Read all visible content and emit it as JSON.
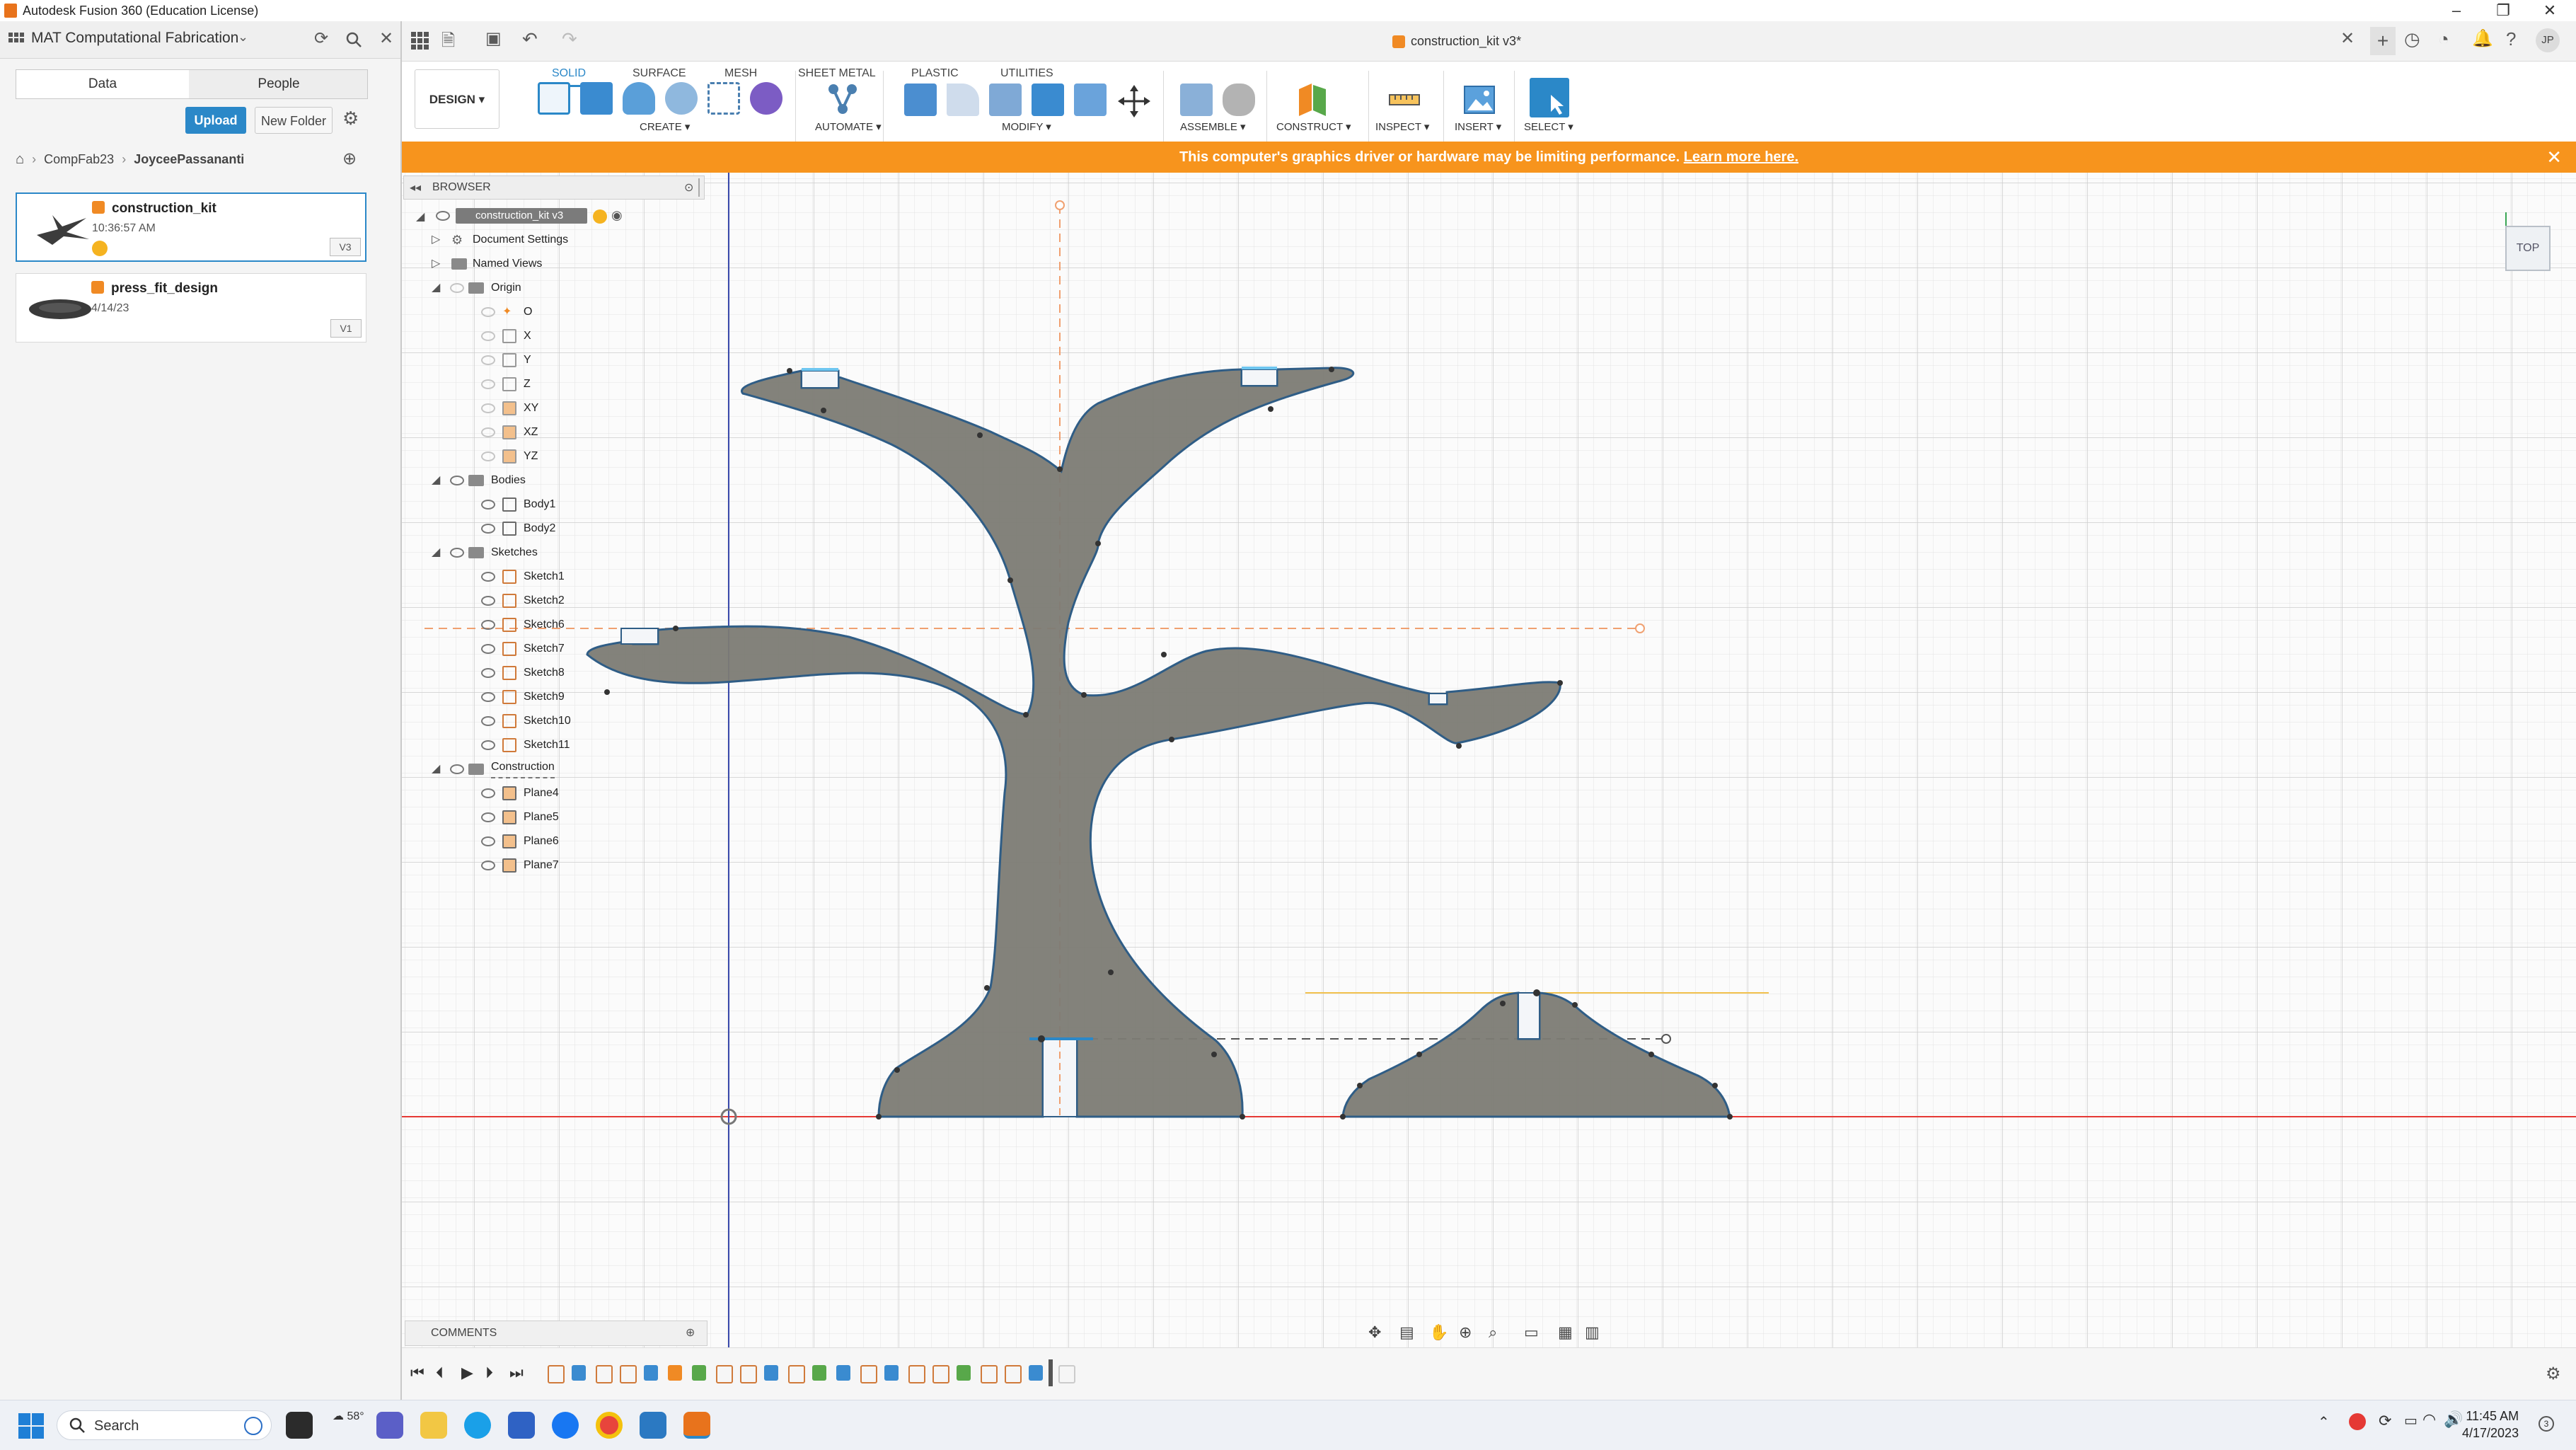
{
  "window": {
    "title": "Autodesk Fusion 360 (Education License)",
    "minimize": "–",
    "maximize": "❐",
    "close": "✕"
  },
  "data_panel": {
    "team": "MAT Computational Fabrication",
    "tabs": [
      "Data",
      "People"
    ],
    "upload": "Upload",
    "new_folder": "New Folder",
    "breadcrumb": [
      "CompFab23",
      "JoyceePassananti"
    ],
    "files": [
      {
        "name": "construction_kit",
        "date": "10:36:57 AM",
        "version": "V3"
      },
      {
        "name": "press_fit_design",
        "date": "4/14/23",
        "version": "V1"
      }
    ]
  },
  "document": {
    "tab_title": "construction_kit v3*",
    "user_initials": "JP"
  },
  "toolbar": {
    "design": "DESIGN",
    "workspace_tabs": [
      "SOLID",
      "SURFACE",
      "MESH",
      "SHEET METAL",
      "PLASTIC",
      "UTILITIES"
    ],
    "groups": [
      "CREATE",
      "AUTOMATE",
      "MODIFY",
      "ASSEMBLE",
      "CONSTRUCT",
      "INSPECT",
      "INSERT",
      "SELECT"
    ]
  },
  "warning": {
    "text": "This computer's graphics driver or hardware may be limiting performance.",
    "link": "Learn more here."
  },
  "browser": {
    "title": "BROWSER",
    "root": "construction_kit v3",
    "document_settings": "Document Settings",
    "named_views": "Named Views",
    "origin": {
      "label": "Origin",
      "items": [
        "O",
        "X",
        "Y",
        "Z",
        "XY",
        "XZ",
        "YZ"
      ]
    },
    "bodies": {
      "label": "Bodies",
      "items": [
        "Body1",
        "Body2"
      ]
    },
    "sketches": {
      "label": "Sketches",
      "items": [
        "Sketch1",
        "Sketch2",
        "Sketch6",
        "Sketch7",
        "Sketch8",
        "Sketch9",
        "Sketch10",
        "Sketch11"
      ]
    },
    "construction": {
      "label": "Construction",
      "items": [
        "Plane4",
        "Plane5",
        "Plane6",
        "Plane7"
      ]
    }
  },
  "viewcube": {
    "face": "TOP"
  },
  "comments": {
    "label": "COMMENTS"
  },
  "taskbar": {
    "search": "Search",
    "weather": "58°",
    "time": "11:45 AM",
    "date": "4/17/2023"
  },
  "colors": {
    "accent": "#2b88c8",
    "warning": "#f7941d",
    "body_fill": "#7c7b74",
    "sketch_line": "#2f5d86",
    "x_axis": "#e53935",
    "y_axis": "#3949ab",
    "fusion_orange": "#e8731c"
  }
}
